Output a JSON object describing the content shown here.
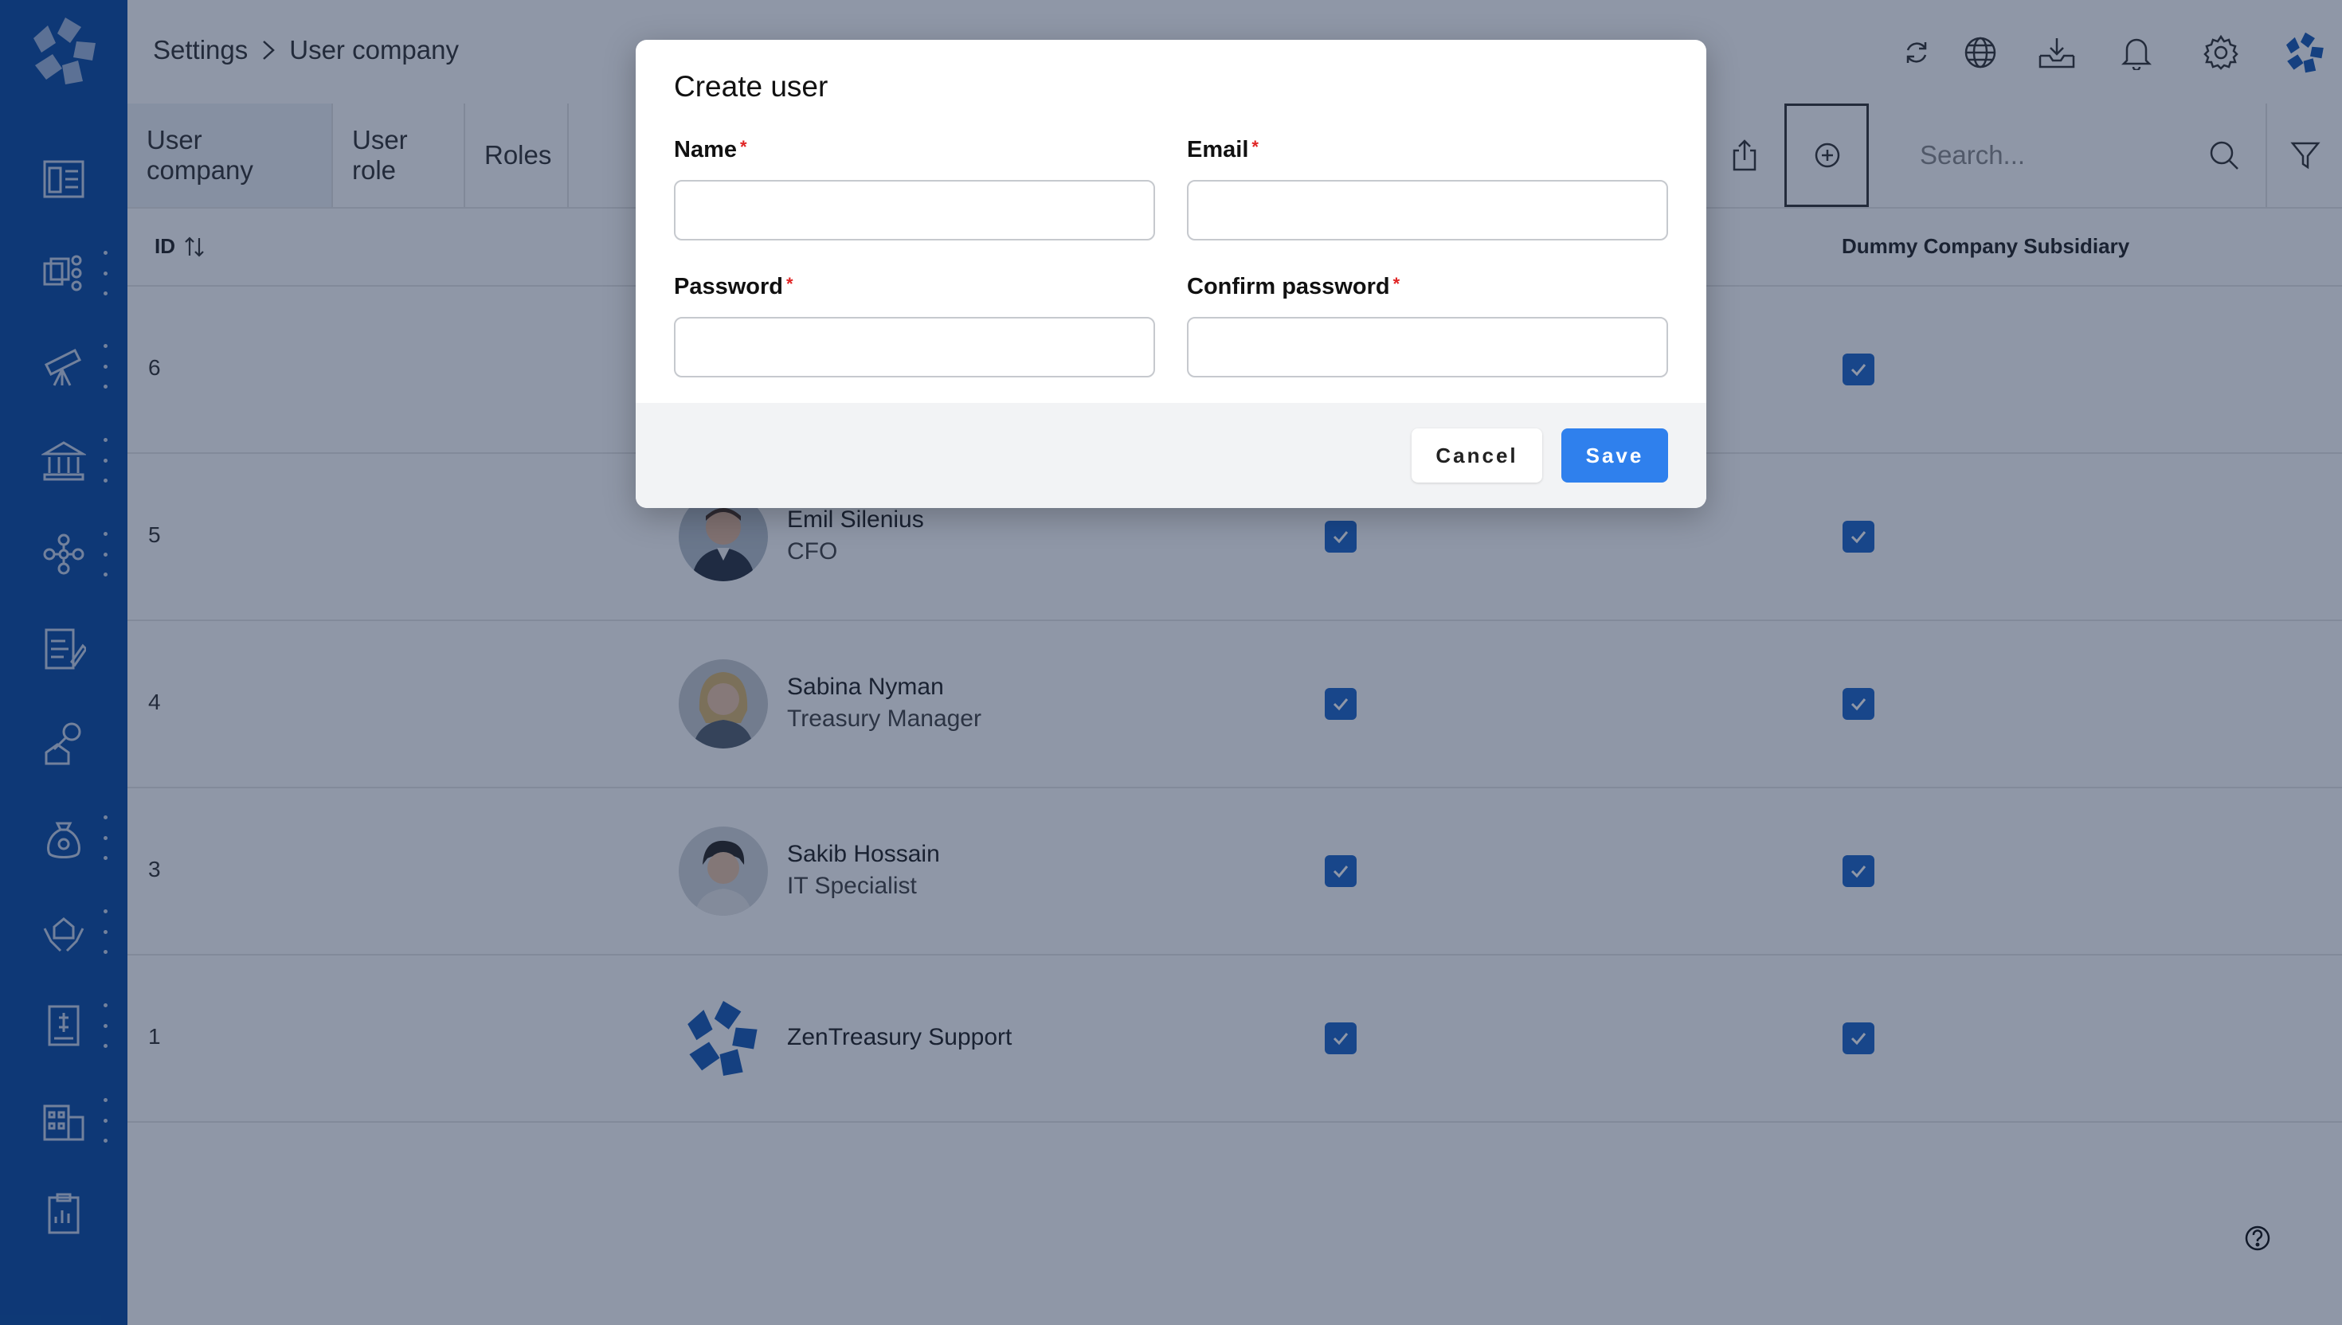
{
  "breadcrumb": {
    "root": "Settings",
    "current": "User company"
  },
  "tabs": [
    {
      "label": "User company",
      "active": true
    },
    {
      "label": "User role",
      "active": false
    },
    {
      "label": "Roles",
      "active": false
    }
  ],
  "search": {
    "placeholder": "Search..."
  },
  "table": {
    "columns": {
      "id": "ID",
      "subsidiary": "Dummy Company Subsidiary"
    },
    "rows": [
      {
        "id": "6",
        "name": "",
        "title": ""
      },
      {
        "id": "5",
        "name": "Emil Silenius",
        "title": "CFO"
      },
      {
        "id": "4",
        "name": "Sabina Nyman",
        "title": "Treasury Manager"
      },
      {
        "id": "3",
        "name": "Sakib Hossain",
        "title": "IT Specialist"
      },
      {
        "id": "1",
        "name": "ZenTreasury Support",
        "title": ""
      }
    ]
  },
  "modal": {
    "title": "Create user",
    "fields": {
      "name": {
        "label": "Name",
        "value": ""
      },
      "email": {
        "label": "Email",
        "value": ""
      },
      "password": {
        "label": "Password",
        "value": ""
      },
      "confirm": {
        "label": "Confirm password",
        "value": ""
      }
    },
    "required_marker": "*",
    "cancel": "Cancel",
    "save": "Save"
  },
  "icons": {
    "sidebar": [
      "dashboard-icon",
      "documents-icon",
      "telescope-icon",
      "bank-icon",
      "network-icon",
      "invoice-icon",
      "key-house-icon",
      "money-bag-icon",
      "hands-house-icon",
      "ledger-icon",
      "building-icon",
      "clipboard-icon"
    ],
    "header": [
      "refresh-icon",
      "globe-icon",
      "download-icon",
      "bell-icon",
      "gear-icon",
      "company-logo-icon"
    ],
    "toolbar": [
      "share-icon",
      "add-icon",
      "search-icon",
      "filter-icon"
    ]
  },
  "colors": {
    "brand": "#0c4da2",
    "accent": "#2f80ed",
    "checkbox": "#1f66c8",
    "required": "#e02424"
  }
}
